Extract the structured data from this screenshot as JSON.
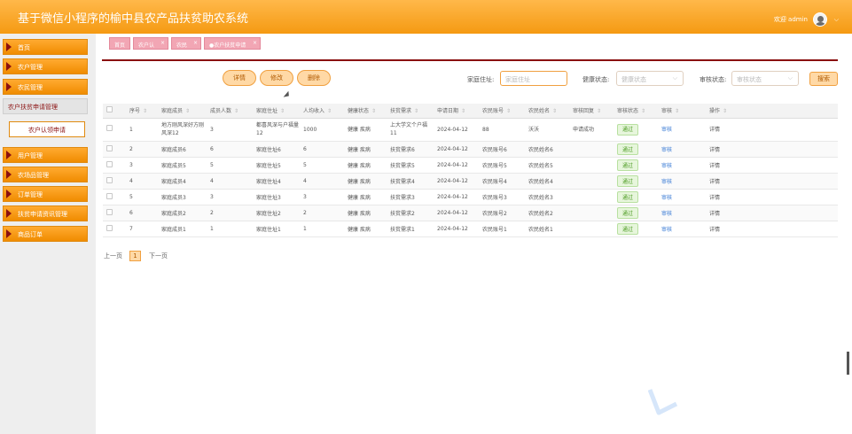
{
  "app": {
    "title": "基于微信小程序的榆中县农产品扶贫助农系统",
    "welcome": "欢迎 admin",
    "caret": "⌵"
  },
  "sidebar": {
    "items": [
      {
        "label": "首页"
      },
      {
        "label": "农户管理"
      },
      {
        "label": "农民管理"
      },
      {
        "label": "农户扶贫申请管理"
      },
      {
        "label": "农户认领申请"
      },
      {
        "label": "用户管理"
      },
      {
        "label": "农场品管理"
      },
      {
        "label": "订单管理"
      },
      {
        "label": "扶贫申请资讯管理"
      },
      {
        "label": "商品订单"
      }
    ]
  },
  "tabs": [
    {
      "label": "首页",
      "close": ""
    },
    {
      "label": "农户认",
      "close": "×"
    },
    {
      "label": "农民",
      "close": "×"
    },
    {
      "label": "●农户扶贫申请",
      "close": "×"
    }
  ],
  "toolbar": {
    "details": "详情",
    "edit": "修改",
    "delete": "删除"
  },
  "filters": {
    "address_label": "家庭住址:",
    "address_placeholder": "家庭住址",
    "health_label": "健康状态:",
    "health_placeholder": "健康状态",
    "audit_label": "审核状态:",
    "audit_placeholder": "审核状态",
    "select_arrow": "⌵",
    "search": "搜索"
  },
  "table": {
    "sort_icon": "⇕",
    "headers": [
      "序号",
      "家庭成员",
      "成员人数",
      "家庭住址",
      "人均收入",
      "健康状态",
      "扶贫需求",
      "申请日期",
      "农民账号",
      "农民姓名",
      "审核回复",
      "审核状态",
      "审核",
      "操作"
    ],
    "rows": [
      {
        "seq": "1",
        "member": "地方刚风深好方刚风深12",
        "count": "3",
        "address": "都喜风深与户福量12",
        "income": "1000",
        "health": "健康 疾病",
        "need": "上大学文个户福11",
        "date": "2024-04-12",
        "account": "88",
        "name": "沃沃",
        "reply": "申请成功",
        "status": "通过",
        "audit": "审核",
        "op": "详情"
      },
      {
        "seq": "2",
        "member": "家庭成员6",
        "count": "6",
        "address": "家庭住址6",
        "income": "6",
        "health": "健康 疾病",
        "need": "扶贫需求6",
        "date": "2024-04-12",
        "account": "农民账号6",
        "name": "农民姓名6",
        "reply": "",
        "status": "通过",
        "audit": "审核",
        "op": "详情"
      },
      {
        "seq": "3",
        "member": "家庭成员5",
        "count": "5",
        "address": "家庭住址5",
        "income": "5",
        "health": "健康 疾病",
        "need": "扶贫需求5",
        "date": "2024-04-12",
        "account": "农民账号5",
        "name": "农民姓名5",
        "reply": "",
        "status": "通过",
        "audit": "审核",
        "op": "详情"
      },
      {
        "seq": "4",
        "member": "家庭成员4",
        "count": "4",
        "address": "家庭住址4",
        "income": "4",
        "health": "健康 疾病",
        "need": "扶贫需求4",
        "date": "2024-04-12",
        "account": "农民账号4",
        "name": "农民姓名4",
        "reply": "",
        "status": "通过",
        "audit": "审核",
        "op": "详情"
      },
      {
        "seq": "5",
        "member": "家庭成员3",
        "count": "3",
        "address": "家庭住址3",
        "income": "3",
        "health": "健康 疾病",
        "need": "扶贫需求3",
        "date": "2024-04-12",
        "account": "农民账号3",
        "name": "农民姓名3",
        "reply": "",
        "status": "通过",
        "audit": "审核",
        "op": "详情"
      },
      {
        "seq": "6",
        "member": "家庭成员2",
        "count": "2",
        "address": "家庭住址2",
        "income": "2",
        "health": "健康 疾病",
        "need": "扶贫需求2",
        "date": "2024-04-12",
        "account": "农民账号2",
        "name": "农民姓名2",
        "reply": "",
        "status": "通过",
        "audit": "审核",
        "op": "详情"
      },
      {
        "seq": "7",
        "member": "家庭成员1",
        "count": "1",
        "address": "家庭住址1",
        "income": "1",
        "health": "健康 疾病",
        "need": "扶贫需求1",
        "date": "2024-04-12",
        "account": "农民账号1",
        "name": "农民姓名1",
        "reply": "",
        "status": "通过",
        "audit": "审核",
        "op": "详情"
      }
    ]
  },
  "pager": {
    "prev": "上一页",
    "current": "1",
    "next": "下一页"
  },
  "colors": {
    "header": "#f5a623",
    "accent": "#8a1010",
    "tab": "#f2a6b4",
    "button_fill": "#ffd9a6",
    "pass": "#4a9a20",
    "link": "#3a7bd5"
  }
}
